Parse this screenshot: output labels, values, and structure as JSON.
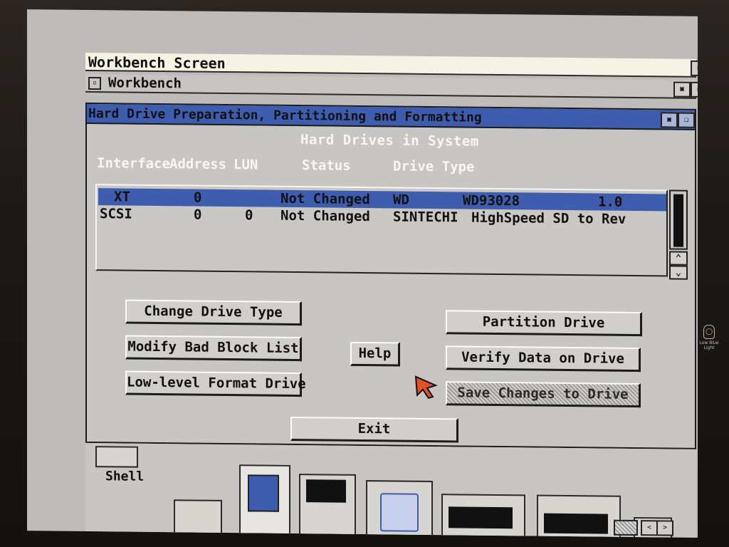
{
  "workbench_screen": {
    "title": "Workbench Screen"
  },
  "workbench_window": {
    "title": "Workbench"
  },
  "hd_window": {
    "title": "Hard Drive Preparation, Partitioning and Formatting",
    "section_title": "Hard Drives in System",
    "columns": [
      "Interface",
      "Address",
      "LUN",
      "Status",
      "Drive Type"
    ],
    "drives": [
      {
        "interface": "XT",
        "address": "0",
        "lun": "",
        "status": "Not Changed",
        "vendor": "WD",
        "model": "WD93028",
        "revision": "1.0",
        "selected": true
      },
      {
        "interface": "SCSI",
        "address": "0",
        "lun": "0",
        "status": "Not Changed",
        "vendor": "SINTECHI",
        "model": "HighSpeed SD to Rev",
        "revision": "",
        "selected": false
      }
    ],
    "buttons": {
      "change_drive_type": "Change Drive Type",
      "modify_bad_block_list": "Modify Bad Block List",
      "low_level_format": "Low-level Format Drive",
      "help": "Help",
      "partition_drive": "Partition Drive",
      "verify_data": "Verify Data on Drive",
      "save_changes": "Save Changes to Drive",
      "exit": "Exit"
    }
  },
  "desktop_icons": {
    "shell_label": "Shell"
  },
  "monitor": {
    "light_label": "Low Blue Light"
  },
  "colors": {
    "highlight": "#3f5dae",
    "window_bg": "#c7c6c2",
    "pointer": "#e0522a"
  },
  "icons": [
    "close-icon",
    "depth-icon",
    "zoom-icon",
    "scroll-up-icon",
    "scroll-down-icon",
    "mouse-pointer-icon"
  ]
}
